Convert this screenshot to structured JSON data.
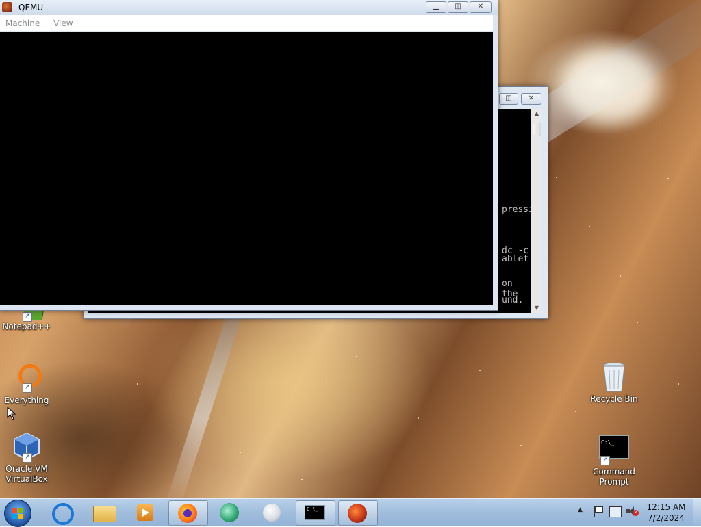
{
  "qemu": {
    "title": "QEMU",
    "menu": [
      "Machine",
      "View"
    ],
    "controls": {
      "minimize": "minimize-icon",
      "restore": "restore-icon",
      "close": "close-icon"
    }
  },
  "console": {
    "lines": [
      "pressi",
      "dc -c",
      "ablet",
      "on the",
      "und."
    ],
    "controls": {
      "restore": "restore-icon",
      "close": "close-icon"
    }
  },
  "desktop": {
    "icons": [
      {
        "label": "Notepad++",
        "icon": "notepadpp-icon"
      },
      {
        "label": "Everything",
        "icon": "everything-icon"
      },
      {
        "label": "Oracle VM VirtualBox",
        "icon": "virtualbox-icon"
      },
      {
        "label": "Recycle Bin",
        "icon": "recycle-bin-icon"
      },
      {
        "label": "Command Prompt",
        "icon": "command-prompt-icon"
      }
    ],
    "cmd_icon_text": "C:\\_"
  },
  "taskbar": {
    "start": "start-orb-icon",
    "pinned": [
      "internet-explorer-icon",
      "file-explorer-icon",
      "media-player-icon",
      "firefox-icon",
      "green-app-icon",
      "white-orb-icon",
      "command-prompt-icon",
      "qemu-icon"
    ],
    "cmd_text": "C:\\_",
    "time": "12:15 AM",
    "date": "7/2/2024",
    "tray": [
      "show-hidden-icons-arrow",
      "action-center-flag-icon",
      "network-icon",
      "volume-muted-icon"
    ]
  },
  "colors": {
    "titlebar": "#cfdbeb",
    "taskbar": "#a2bedd",
    "console_bg": "#000000"
  }
}
